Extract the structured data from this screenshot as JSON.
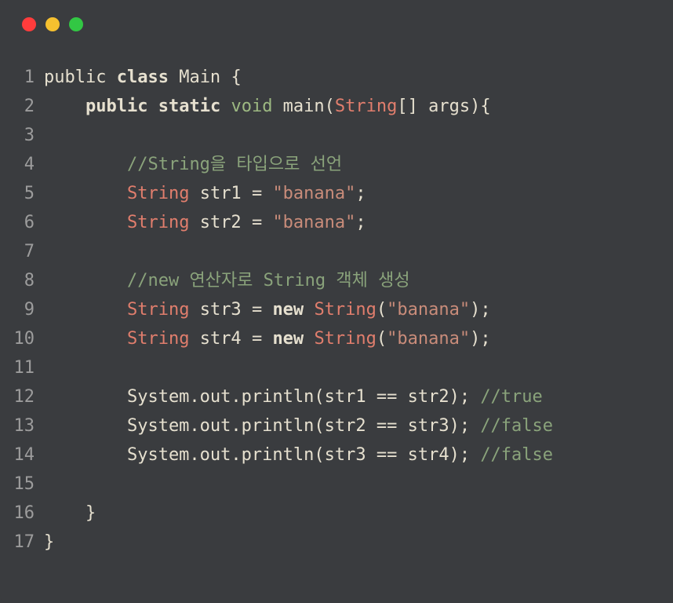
{
  "lines": [
    {
      "num": "1",
      "tokens": [
        {
          "cls": "tok-id",
          "t": "public "
        },
        {
          "cls": "tok-keyword",
          "t": "class"
        },
        {
          "cls": "tok-id",
          "t": " Main "
        },
        {
          "cls": "tok-punct",
          "t": "{"
        }
      ]
    },
    {
      "num": "2",
      "tokens": [
        {
          "cls": "tok-id",
          "t": "    "
        },
        {
          "cls": "tok-keyword",
          "t": "public"
        },
        {
          "cls": "tok-id",
          "t": " "
        },
        {
          "cls": "tok-keyword",
          "t": "static"
        },
        {
          "cls": "tok-id",
          "t": " "
        },
        {
          "cls": "tok-type-void",
          "t": "void"
        },
        {
          "cls": "tok-id",
          "t": " main"
        },
        {
          "cls": "tok-punct",
          "t": "("
        },
        {
          "cls": "tok-type",
          "t": "String"
        },
        {
          "cls": "tok-punct",
          "t": "[] "
        },
        {
          "cls": "tok-id",
          "t": "args"
        },
        {
          "cls": "tok-punct",
          "t": "){"
        }
      ]
    },
    {
      "num": "3",
      "tokens": []
    },
    {
      "num": "4",
      "tokens": [
        {
          "cls": "tok-id",
          "t": "        "
        },
        {
          "cls": "tok-comment",
          "t": "//String을 타입으로 선언"
        }
      ]
    },
    {
      "num": "5",
      "tokens": [
        {
          "cls": "tok-id",
          "t": "        "
        },
        {
          "cls": "tok-type",
          "t": "String"
        },
        {
          "cls": "tok-id",
          "t": " str1 "
        },
        {
          "cls": "tok-op",
          "t": "="
        },
        {
          "cls": "tok-id",
          "t": " "
        },
        {
          "cls": "tok-string",
          "t": "\"banana\""
        },
        {
          "cls": "tok-punct",
          "t": ";"
        }
      ]
    },
    {
      "num": "6",
      "tokens": [
        {
          "cls": "tok-id",
          "t": "        "
        },
        {
          "cls": "tok-type",
          "t": "String"
        },
        {
          "cls": "tok-id",
          "t": " str2 "
        },
        {
          "cls": "tok-op",
          "t": "="
        },
        {
          "cls": "tok-id",
          "t": " "
        },
        {
          "cls": "tok-string",
          "t": "\"banana\""
        },
        {
          "cls": "tok-punct",
          "t": ";"
        }
      ]
    },
    {
      "num": "7",
      "tokens": []
    },
    {
      "num": "8",
      "tokens": [
        {
          "cls": "tok-id",
          "t": "        "
        },
        {
          "cls": "tok-comment",
          "t": "//new 연산자로 String 객체 생성"
        }
      ]
    },
    {
      "num": "9",
      "tokens": [
        {
          "cls": "tok-id",
          "t": "        "
        },
        {
          "cls": "tok-type",
          "t": "String"
        },
        {
          "cls": "tok-id",
          "t": " str3 "
        },
        {
          "cls": "tok-op",
          "t": "="
        },
        {
          "cls": "tok-id",
          "t": " "
        },
        {
          "cls": "tok-keyword",
          "t": "new"
        },
        {
          "cls": "tok-id",
          "t": " "
        },
        {
          "cls": "tok-type",
          "t": "String"
        },
        {
          "cls": "tok-punct",
          "t": "("
        },
        {
          "cls": "tok-string",
          "t": "\"banana\""
        },
        {
          "cls": "tok-punct",
          "t": ");"
        }
      ]
    },
    {
      "num": "10",
      "tokens": [
        {
          "cls": "tok-id",
          "t": "        "
        },
        {
          "cls": "tok-type",
          "t": "String"
        },
        {
          "cls": "tok-id",
          "t": " str4 "
        },
        {
          "cls": "tok-op",
          "t": "="
        },
        {
          "cls": "tok-id",
          "t": " "
        },
        {
          "cls": "tok-keyword",
          "t": "new"
        },
        {
          "cls": "tok-id",
          "t": " "
        },
        {
          "cls": "tok-type",
          "t": "String"
        },
        {
          "cls": "tok-punct",
          "t": "("
        },
        {
          "cls": "tok-string",
          "t": "\"banana\""
        },
        {
          "cls": "tok-punct",
          "t": ");"
        }
      ]
    },
    {
      "num": "11",
      "tokens": []
    },
    {
      "num": "12",
      "tokens": [
        {
          "cls": "tok-id",
          "t": "        System.out.println(str1 "
        },
        {
          "cls": "tok-op",
          "t": "=="
        },
        {
          "cls": "tok-id",
          "t": " str2); "
        },
        {
          "cls": "tok-comment",
          "t": "//true"
        }
      ]
    },
    {
      "num": "13",
      "tokens": [
        {
          "cls": "tok-id",
          "t": "        System.out.println(str2 "
        },
        {
          "cls": "tok-op",
          "t": "=="
        },
        {
          "cls": "tok-id",
          "t": " str3); "
        },
        {
          "cls": "tok-comment",
          "t": "//false"
        }
      ]
    },
    {
      "num": "14",
      "tokens": [
        {
          "cls": "tok-id",
          "t": "        System.out.println(str3 "
        },
        {
          "cls": "tok-op",
          "t": "=="
        },
        {
          "cls": "tok-id",
          "t": " str4); "
        },
        {
          "cls": "tok-comment",
          "t": "//false"
        }
      ]
    },
    {
      "num": "15",
      "tokens": []
    },
    {
      "num": "16",
      "tokens": [
        {
          "cls": "tok-id",
          "t": "    "
        },
        {
          "cls": "tok-punct",
          "t": "}"
        }
      ]
    },
    {
      "num": "17",
      "tokens": [
        {
          "cls": "tok-punct",
          "t": "}"
        }
      ]
    }
  ]
}
